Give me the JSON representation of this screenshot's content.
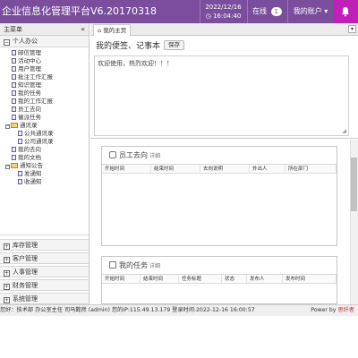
{
  "header": {
    "title": "企业信息化管理平台V6.20170318",
    "date": "2022/12/16",
    "time": "16:04:40",
    "online_label": "在线",
    "online_count": "1",
    "account_label": "我的账户 ▾",
    "accent_color": "#7a4e9c",
    "bell_color": "#c020b8"
  },
  "sidebar": {
    "title": "主菜单",
    "collapse_glyph": "«",
    "office_group": "个人办公",
    "items": [
      "邮信管理",
      "活动中心",
      "用户管理",
      "批注工作汇报",
      "知识管理",
      "我的任务",
      "我的工作汇报",
      "员工去向",
      "催派任务",
      "通讯录",
      "公共通讯录",
      "公司通讯录",
      "我的去向",
      "我的文档",
      "通知公告",
      "发通知",
      "收通知"
    ],
    "bottom_groups": [
      "库存管理",
      "客户管理",
      "人事管理",
      "财务管理",
      "系统管理"
    ]
  },
  "tabs": {
    "home": "我的主页",
    "scroll_glyph": "▾"
  },
  "notes": {
    "title": "我的便签、记事本",
    "save_label": "保存",
    "content": "欢迎使用，热烈欢迎！！！"
  },
  "staff_panel": {
    "title": "员工去向",
    "detail": "详细",
    "columns": [
      "开始时间",
      "结束时间",
      "去向说明",
      "外出人",
      "所在部门"
    ]
  },
  "task_panel": {
    "title": "我的任务",
    "detail": "详细",
    "columns": [
      "开始时间",
      "结束时间",
      "任务标题",
      "状态",
      "发布人",
      "发布时间"
    ]
  },
  "footer": {
    "status": "您好：技术部 办公室主任 司马懿然 (admin)  您的IP:115.49.13.179  登录时间:2022-12-16 16:00:57",
    "power_label": "Power by ",
    "brand": "思纤者"
  }
}
